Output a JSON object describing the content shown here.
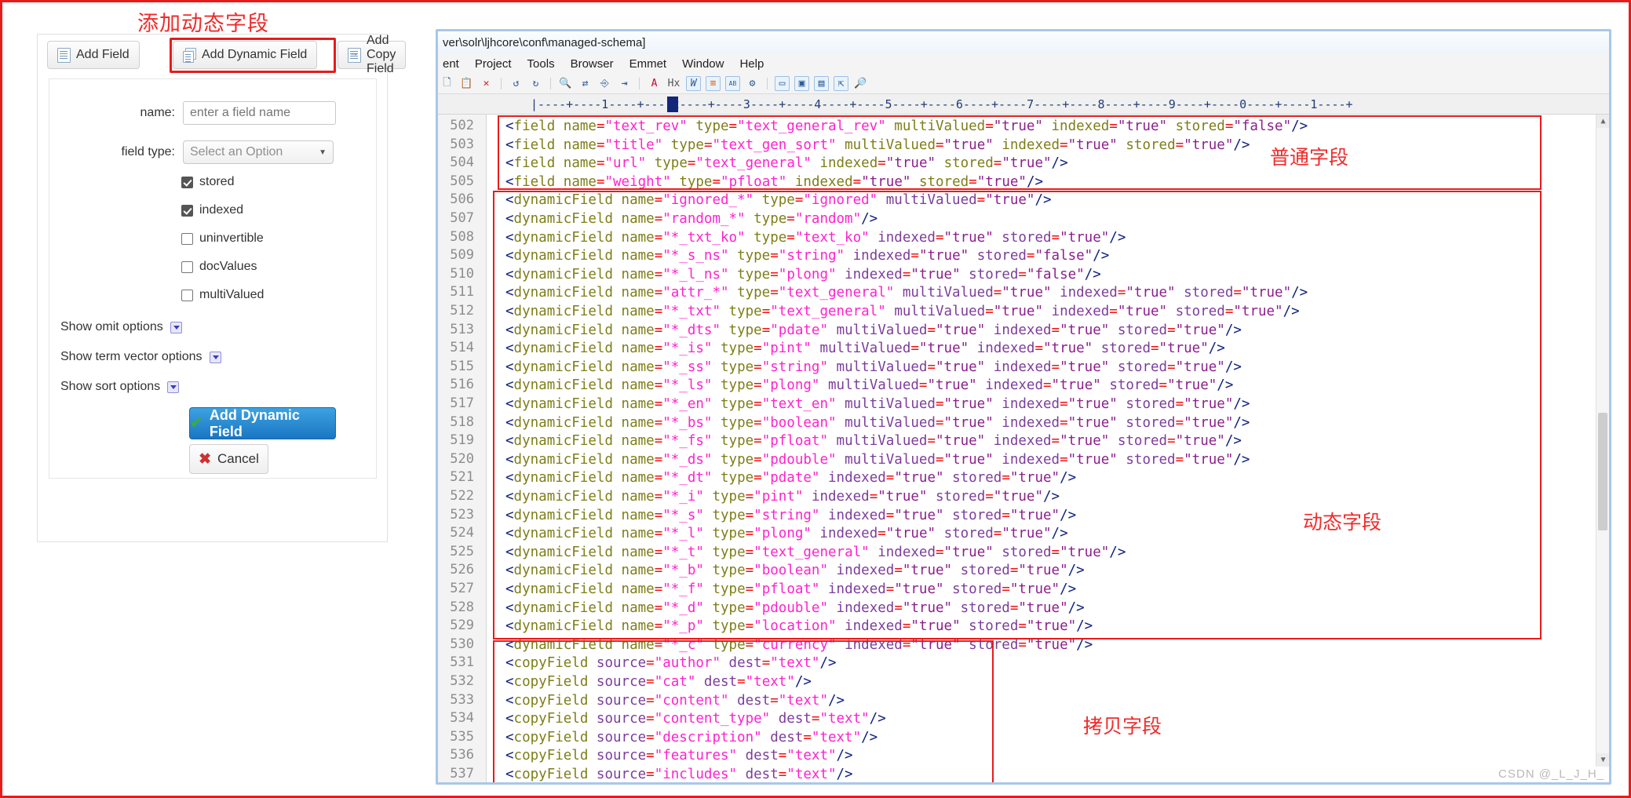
{
  "annotations": {
    "title_top": "添加动态字段",
    "normal_field": "普通字段",
    "dynamic_field": "动态字段",
    "copy_field": "拷贝字段",
    "accent_color": "#e81b1b"
  },
  "solr": {
    "tabs": [
      {
        "label": "Add Field",
        "icon": "document-icon",
        "active": false
      },
      {
        "label": "Add Dynamic Field",
        "icon": "document-stack-icon",
        "active": true
      },
      {
        "label": "Add Copy Field",
        "icon": "document-arrow-icon",
        "active": false
      }
    ],
    "form": {
      "name_label": "name:",
      "name_placeholder": "enter a field name",
      "name_value": "",
      "fieldtype_label": "field type:",
      "fieldtype_value": "Select an Option",
      "checkboxes": [
        {
          "label": "stored",
          "checked": true
        },
        {
          "label": "indexed",
          "checked": true
        },
        {
          "label": "uninvertible",
          "checked": false
        },
        {
          "label": "docValues",
          "checked": false
        },
        {
          "label": "multiValued",
          "checked": false
        }
      ],
      "toggles": [
        {
          "label": "Show omit options"
        },
        {
          "label": "Show term vector options"
        },
        {
          "label": "Show sort options"
        }
      ],
      "submit_label": "Add Dynamic Field",
      "cancel_label": "Cancel"
    }
  },
  "editor": {
    "title": "ver\\solr\\ljhcore\\conf\\managed-schema]",
    "menu": [
      "ent",
      "Project",
      "Tools",
      "Browser",
      "Emmet",
      "Window",
      "Help"
    ],
    "ruler": "|----+----1----+----2----+----3----+----4----+----5----+----6----+----7----+----8----+----9----+----0----+----1----+",
    "watermark": "CSDN @_L_J_H_",
    "first_line_number": 502,
    "lines": [
      {
        "n": 502,
        "tag": "field",
        "attrs": [
          [
            "name",
            "text_rev"
          ],
          [
            "type",
            "text_general_rev"
          ],
          [
            "multiValued",
            "true"
          ],
          [
            "indexed",
            "true"
          ],
          [
            "stored",
            "false"
          ]
        ]
      },
      {
        "n": 503,
        "tag": "field",
        "attrs": [
          [
            "name",
            "title"
          ],
          [
            "type",
            "text_gen_sort"
          ],
          [
            "multiValued",
            "true"
          ],
          [
            "indexed",
            "true"
          ],
          [
            "stored",
            "true"
          ]
        ]
      },
      {
        "n": 504,
        "tag": "field",
        "attrs": [
          [
            "name",
            "url"
          ],
          [
            "type",
            "text_general"
          ],
          [
            "indexed",
            "true"
          ],
          [
            "stored",
            "true"
          ]
        ]
      },
      {
        "n": 505,
        "tag": "field",
        "attrs": [
          [
            "name",
            "weight"
          ],
          [
            "type",
            "pfloat"
          ],
          [
            "indexed",
            "true"
          ],
          [
            "stored",
            "true"
          ]
        ]
      },
      {
        "n": 506,
        "tag": "dynamicField",
        "attrs": [
          [
            "name",
            "ignored_*"
          ],
          [
            "type",
            "ignored"
          ],
          [
            "multiValued",
            "true"
          ]
        ]
      },
      {
        "n": 507,
        "tag": "dynamicField",
        "attrs": [
          [
            "name",
            "random_*"
          ],
          [
            "type",
            "random"
          ]
        ]
      },
      {
        "n": 508,
        "tag": "dynamicField",
        "attrs": [
          [
            "name",
            "*_txt_ko"
          ],
          [
            "type",
            "text_ko"
          ],
          [
            "indexed",
            "true"
          ],
          [
            "stored",
            "true"
          ]
        ]
      },
      {
        "n": 509,
        "tag": "dynamicField",
        "attrs": [
          [
            "name",
            "*_s_ns"
          ],
          [
            "type",
            "string"
          ],
          [
            "indexed",
            "true"
          ],
          [
            "stored",
            "false"
          ]
        ]
      },
      {
        "n": 510,
        "tag": "dynamicField",
        "attrs": [
          [
            "name",
            "*_l_ns"
          ],
          [
            "type",
            "plong"
          ],
          [
            "indexed",
            "true"
          ],
          [
            "stored",
            "false"
          ]
        ]
      },
      {
        "n": 511,
        "tag": "dynamicField",
        "attrs": [
          [
            "name",
            "attr_*"
          ],
          [
            "type",
            "text_general"
          ],
          [
            "multiValued",
            "true"
          ],
          [
            "indexed",
            "true"
          ],
          [
            "stored",
            "true"
          ]
        ]
      },
      {
        "n": 512,
        "tag": "dynamicField",
        "attrs": [
          [
            "name",
            "*_txt"
          ],
          [
            "type",
            "text_general"
          ],
          [
            "multiValued",
            "true"
          ],
          [
            "indexed",
            "true"
          ],
          [
            "stored",
            "true"
          ]
        ]
      },
      {
        "n": 513,
        "tag": "dynamicField",
        "attrs": [
          [
            "name",
            "*_dts"
          ],
          [
            "type",
            "pdate"
          ],
          [
            "multiValued",
            "true"
          ],
          [
            "indexed",
            "true"
          ],
          [
            "stored",
            "true"
          ]
        ]
      },
      {
        "n": 514,
        "tag": "dynamicField",
        "attrs": [
          [
            "name",
            "*_is"
          ],
          [
            "type",
            "pint"
          ],
          [
            "multiValued",
            "true"
          ],
          [
            "indexed",
            "true"
          ],
          [
            "stored",
            "true"
          ]
        ]
      },
      {
        "n": 515,
        "tag": "dynamicField",
        "attrs": [
          [
            "name",
            "*_ss"
          ],
          [
            "type",
            "string"
          ],
          [
            "multiValued",
            "true"
          ],
          [
            "indexed",
            "true"
          ],
          [
            "stored",
            "true"
          ]
        ]
      },
      {
        "n": 516,
        "tag": "dynamicField",
        "attrs": [
          [
            "name",
            "*_ls"
          ],
          [
            "type",
            "plong"
          ],
          [
            "multiValued",
            "true"
          ],
          [
            "indexed",
            "true"
          ],
          [
            "stored",
            "true"
          ]
        ]
      },
      {
        "n": 517,
        "tag": "dynamicField",
        "attrs": [
          [
            "name",
            "*_en"
          ],
          [
            "type",
            "text_en"
          ],
          [
            "multiValued",
            "true"
          ],
          [
            "indexed",
            "true"
          ],
          [
            "stored",
            "true"
          ]
        ]
      },
      {
        "n": 518,
        "tag": "dynamicField",
        "attrs": [
          [
            "name",
            "*_bs"
          ],
          [
            "type",
            "boolean"
          ],
          [
            "multiValued",
            "true"
          ],
          [
            "indexed",
            "true"
          ],
          [
            "stored",
            "true"
          ]
        ]
      },
      {
        "n": 519,
        "tag": "dynamicField",
        "attrs": [
          [
            "name",
            "*_fs"
          ],
          [
            "type",
            "pfloat"
          ],
          [
            "multiValued",
            "true"
          ],
          [
            "indexed",
            "true"
          ],
          [
            "stored",
            "true"
          ]
        ]
      },
      {
        "n": 520,
        "tag": "dynamicField",
        "attrs": [
          [
            "name",
            "*_ds"
          ],
          [
            "type",
            "pdouble"
          ],
          [
            "multiValued",
            "true"
          ],
          [
            "indexed",
            "true"
          ],
          [
            "stored",
            "true"
          ]
        ]
      },
      {
        "n": 521,
        "tag": "dynamicField",
        "attrs": [
          [
            "name",
            "*_dt"
          ],
          [
            "type",
            "pdate"
          ],
          [
            "indexed",
            "true"
          ],
          [
            "stored",
            "true"
          ]
        ]
      },
      {
        "n": 522,
        "tag": "dynamicField",
        "attrs": [
          [
            "name",
            "*_i"
          ],
          [
            "type",
            "pint"
          ],
          [
            "indexed",
            "true"
          ],
          [
            "stored",
            "true"
          ]
        ]
      },
      {
        "n": 523,
        "tag": "dynamicField",
        "attrs": [
          [
            "name",
            "*_s"
          ],
          [
            "type",
            "string"
          ],
          [
            "indexed",
            "true"
          ],
          [
            "stored",
            "true"
          ]
        ]
      },
      {
        "n": 524,
        "tag": "dynamicField",
        "attrs": [
          [
            "name",
            "*_l"
          ],
          [
            "type",
            "plong"
          ],
          [
            "indexed",
            "true"
          ],
          [
            "stored",
            "true"
          ]
        ]
      },
      {
        "n": 525,
        "tag": "dynamicField",
        "attrs": [
          [
            "name",
            "*_t"
          ],
          [
            "type",
            "text_general"
          ],
          [
            "indexed",
            "true"
          ],
          [
            "stored",
            "true"
          ]
        ]
      },
      {
        "n": 526,
        "tag": "dynamicField",
        "attrs": [
          [
            "name",
            "*_b"
          ],
          [
            "type",
            "boolean"
          ],
          [
            "indexed",
            "true"
          ],
          [
            "stored",
            "true"
          ]
        ]
      },
      {
        "n": 527,
        "tag": "dynamicField",
        "attrs": [
          [
            "name",
            "*_f"
          ],
          [
            "type",
            "pfloat"
          ],
          [
            "indexed",
            "true"
          ],
          [
            "stored",
            "true"
          ]
        ]
      },
      {
        "n": 528,
        "tag": "dynamicField",
        "attrs": [
          [
            "name",
            "*_d"
          ],
          [
            "type",
            "pdouble"
          ],
          [
            "indexed",
            "true"
          ],
          [
            "stored",
            "true"
          ]
        ]
      },
      {
        "n": 529,
        "tag": "dynamicField",
        "attrs": [
          [
            "name",
            "*_p"
          ],
          [
            "type",
            "location"
          ],
          [
            "indexed",
            "true"
          ],
          [
            "stored",
            "true"
          ]
        ]
      },
      {
        "n": 530,
        "tag": "dynamicField",
        "attrs": [
          [
            "name",
            "*_c"
          ],
          [
            "type",
            "currency"
          ],
          [
            "indexed",
            "true"
          ],
          [
            "stored",
            "true"
          ]
        ]
      },
      {
        "n": 531,
        "tag": "copyField",
        "attrs": [
          [
            "source",
            "author"
          ],
          [
            "dest",
            "text"
          ]
        ]
      },
      {
        "n": 532,
        "tag": "copyField",
        "attrs": [
          [
            "source",
            "cat"
          ],
          [
            "dest",
            "text"
          ]
        ]
      },
      {
        "n": 533,
        "tag": "copyField",
        "attrs": [
          [
            "source",
            "content"
          ],
          [
            "dest",
            "text"
          ]
        ]
      },
      {
        "n": 534,
        "tag": "copyField",
        "attrs": [
          [
            "source",
            "content_type"
          ],
          [
            "dest",
            "text"
          ]
        ]
      },
      {
        "n": 535,
        "tag": "copyField",
        "attrs": [
          [
            "source",
            "description"
          ],
          [
            "dest",
            "text"
          ]
        ]
      },
      {
        "n": 536,
        "tag": "copyField",
        "attrs": [
          [
            "source",
            "features"
          ],
          [
            "dest",
            "text"
          ]
        ]
      },
      {
        "n": 537,
        "tag": "copyField",
        "attrs": [
          [
            "source",
            "includes"
          ],
          [
            "dest",
            "text"
          ]
        ]
      }
    ]
  }
}
